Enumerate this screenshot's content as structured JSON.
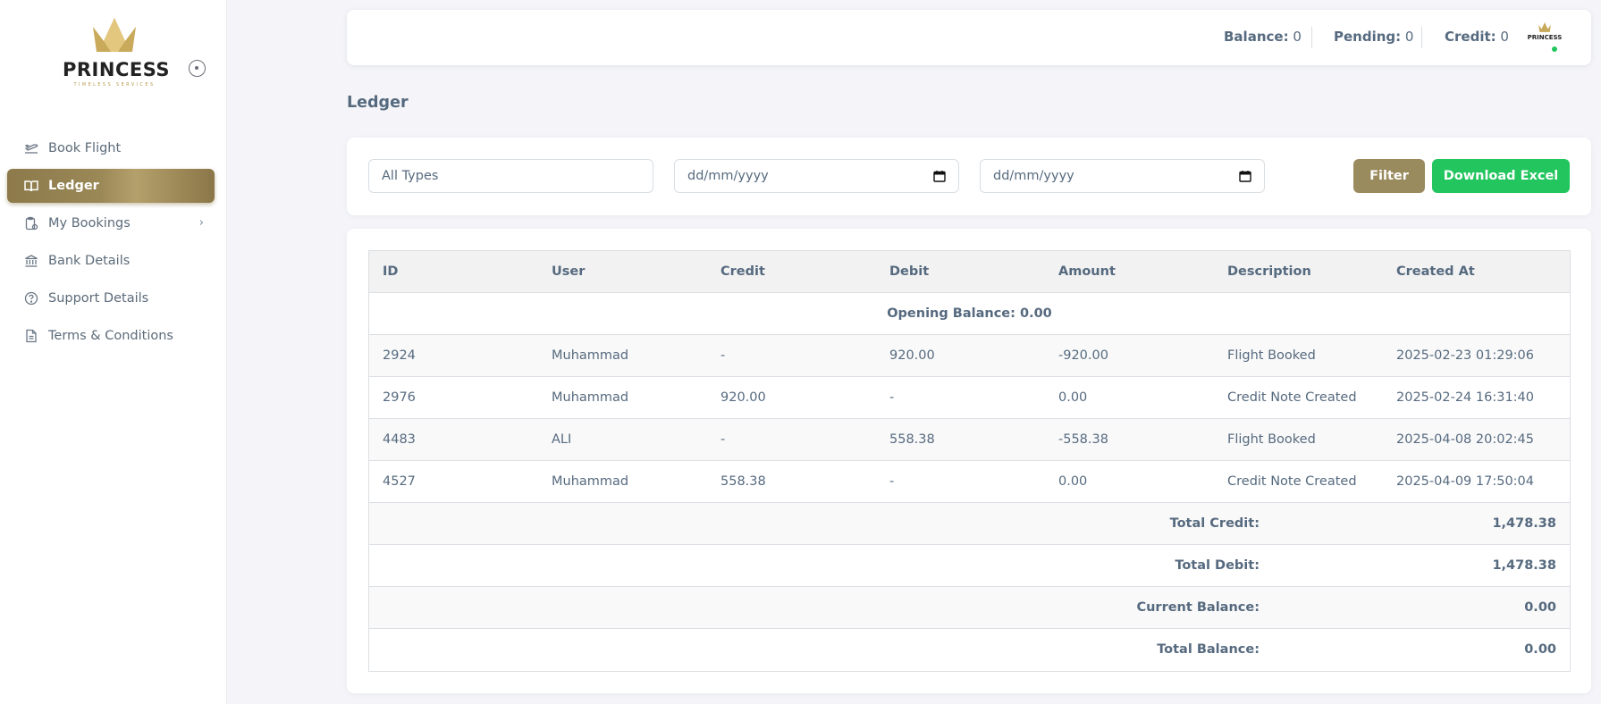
{
  "brand": {
    "name": "PRINCESS",
    "tagline": "TIMELESS SERVICES",
    "accent": "#9a8857",
    "success": "#22c55e"
  },
  "sidebar": {
    "items": [
      {
        "label": "Book Flight",
        "icon": "plane-takeoff-icon",
        "active": false
      },
      {
        "label": "Ledger",
        "icon": "book-open-icon",
        "active": true
      },
      {
        "label": "My Bookings",
        "icon": "bookings-clipboard-icon",
        "active": false,
        "has_submenu": true
      },
      {
        "label": "Bank Details",
        "icon": "bank-icon",
        "active": false
      },
      {
        "label": "Support Details",
        "icon": "help-circle-icon",
        "active": false
      },
      {
        "label": "Terms & Conditions",
        "icon": "document-icon",
        "active": false
      }
    ]
  },
  "topbar": {
    "balance_label": "Balance:",
    "balance_value": "0",
    "pending_label": "Pending:",
    "pending_value": "0",
    "credit_label": "Credit:",
    "credit_value": "0",
    "avatar_text": "PRINCESS"
  },
  "page": {
    "title": "Ledger"
  },
  "filters": {
    "type_placeholder": "All Types",
    "from_date": "dd/mm/yyyy",
    "to_date": "dd/mm/yyyy",
    "filter_label": "Filter",
    "download_label": "Download Excel"
  },
  "table": {
    "columns": [
      "ID",
      "User",
      "Credit",
      "Debit",
      "Amount",
      "Description",
      "Created At"
    ],
    "opening_balance": "Opening Balance: 0.00",
    "rows": [
      {
        "id": "2924",
        "user": "Muhammad",
        "credit": "-",
        "debit": "920.00",
        "amount": "-920.00",
        "description": "Flight Booked",
        "created_at": "2025-02-23 01:29:06"
      },
      {
        "id": "2976",
        "user": "Muhammad",
        "credit": "920.00",
        "debit": "-",
        "amount": "0.00",
        "description": "Credit Note Created",
        "created_at": "2025-02-24 16:31:40"
      },
      {
        "id": "4483",
        "user": "ALI",
        "credit": "-",
        "debit": "558.38",
        "amount": "-558.38",
        "description": "Flight Booked",
        "created_at": "2025-04-08 20:02:45"
      },
      {
        "id": "4527",
        "user": "Muhammad",
        "credit": "558.38",
        "debit": "-",
        "amount": "0.00",
        "description": "Credit Note Created",
        "created_at": "2025-04-09 17:50:04"
      }
    ],
    "summary": [
      {
        "label": "Total Credit:",
        "value": "1,478.38"
      },
      {
        "label": "Total Debit:",
        "value": "1,478.38"
      },
      {
        "label": "Current Balance:",
        "value": "0.00"
      },
      {
        "label": "Total Balance:",
        "value": "0.00"
      }
    ]
  }
}
